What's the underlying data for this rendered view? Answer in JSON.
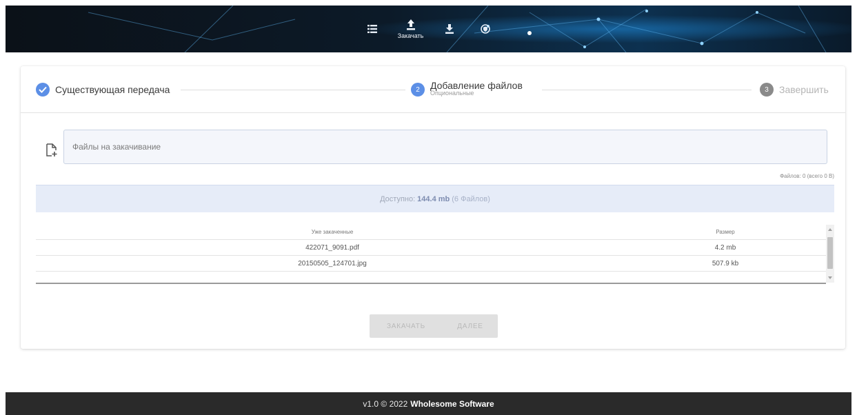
{
  "header": {
    "nav": [
      {
        "icon": "list-icon",
        "label": ""
      },
      {
        "icon": "upload-icon",
        "label": "Закачать",
        "active": true
      },
      {
        "icon": "download-icon",
        "label": ""
      },
      {
        "icon": "shield-icon",
        "label": ""
      }
    ],
    "colors": {
      "accent": "#5c8fe6",
      "header_bg": "#0a1420"
    }
  },
  "stepper": {
    "steps": [
      {
        "number": "✓",
        "label": "Существующая передача",
        "sublabel": "",
        "state": "done"
      },
      {
        "number": "2",
        "label": "Добавление файлов",
        "sublabel": "Опциональные",
        "state": "current"
      },
      {
        "number": "3",
        "label": "Завершить",
        "sublabel": "",
        "state": "pending"
      }
    ]
  },
  "upload": {
    "placeholder": "Файлы на закачивание",
    "count_text": "Файлов: 0 (всего 0 B)"
  },
  "available": {
    "prefix": "Доступно:",
    "amount": "144.4 mb",
    "files": "(6 Файлов)"
  },
  "table": {
    "headers": {
      "name": "Уже закаченные",
      "size": "Размер"
    },
    "rows": [
      {
        "name": "422071_9091.pdf",
        "size": "4.2 mb"
      },
      {
        "name": "20150505_124701.jpg",
        "size": "507.9 kb"
      }
    ]
  },
  "buttons": {
    "upload": "Закачать",
    "next": "Далее"
  },
  "footer": {
    "version": "v1.0 © 2022",
    "company": "Wholesome Software"
  }
}
